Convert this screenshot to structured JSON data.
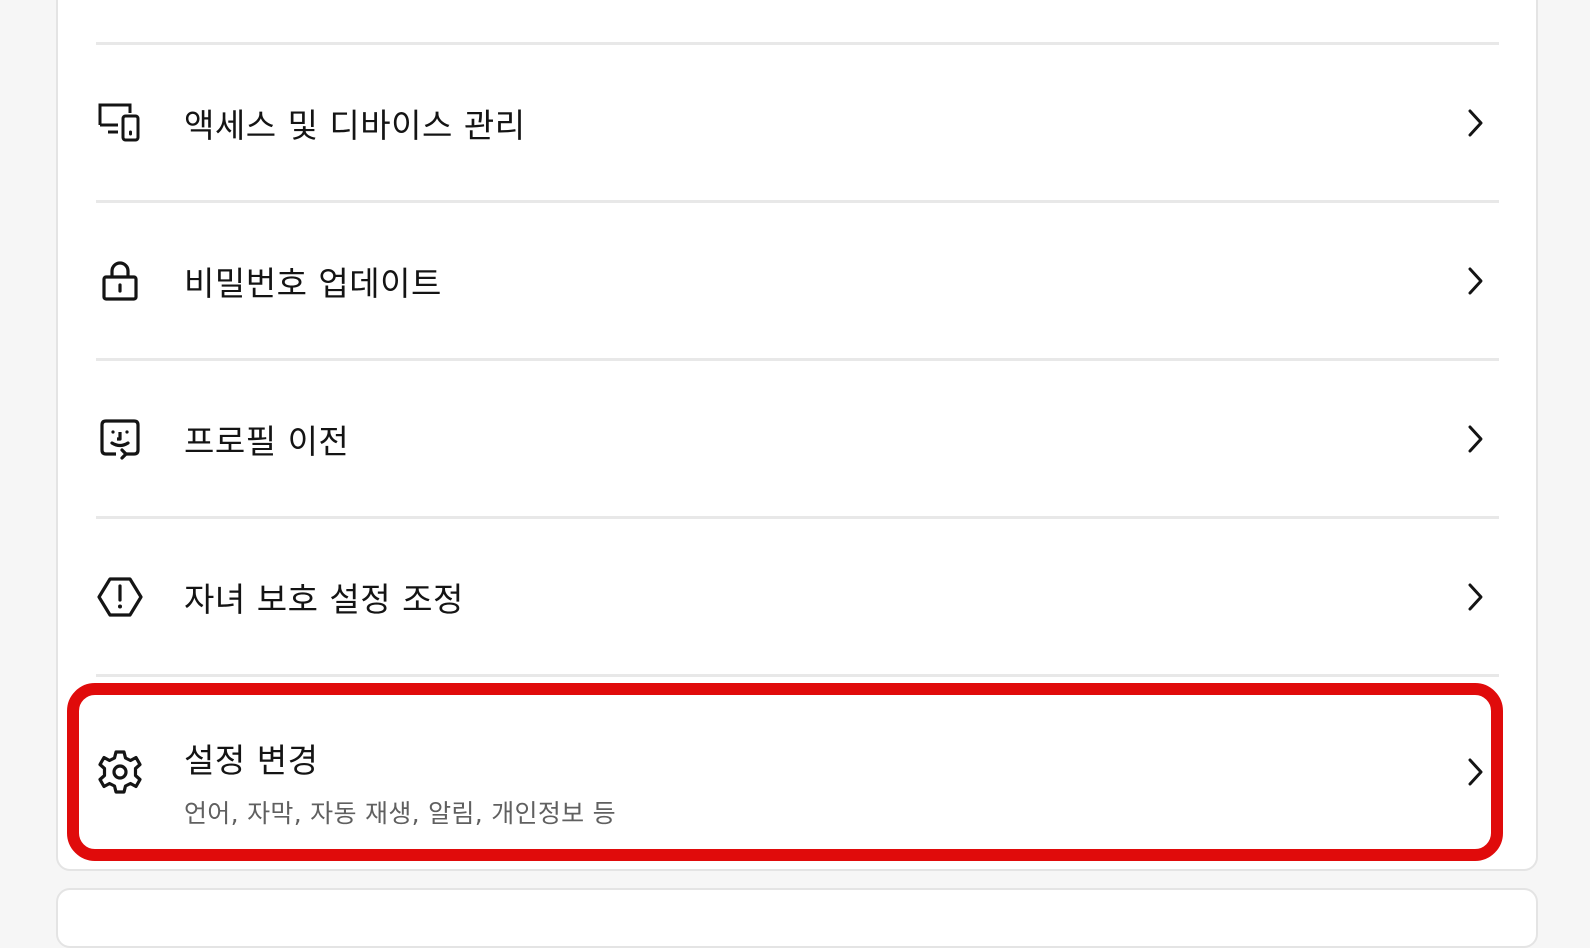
{
  "menu": {
    "items": [
      {
        "label": "액세스 및 디바이스 관리",
        "icon": "devices-icon"
      },
      {
        "label": "비밀번호 업데이트",
        "icon": "lock-icon"
      },
      {
        "label": "프로필 이전",
        "icon": "profile-transfer-icon"
      },
      {
        "label": "자녀 보호 설정 조정",
        "icon": "warning-octagon-icon"
      },
      {
        "label": "설정 변경",
        "sublabel": "언어, 자막, 자동 재생, 알림, 개인정보 등",
        "icon": "gear-icon"
      }
    ]
  },
  "highlight": {
    "color": "#e00b0b",
    "target": "설정 변경"
  }
}
